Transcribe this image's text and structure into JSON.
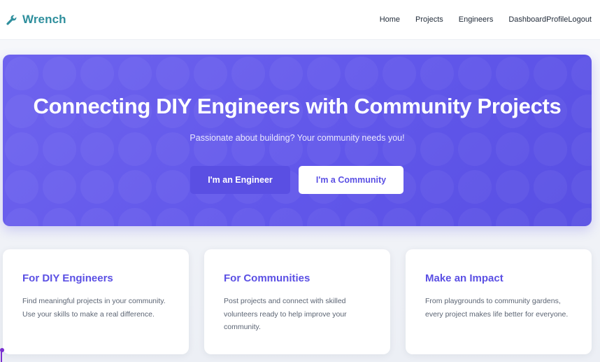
{
  "brand": {
    "name": "Wrench",
    "icon": "wrench-icon",
    "color": "#2f8f9d"
  },
  "nav": {
    "home": "Home",
    "projects": "Projects",
    "engineers": "Engineers",
    "dashboard": "Dashboard",
    "profile": "Profile",
    "logout": "Logout"
  },
  "hero": {
    "title": "Connecting DIY Engineers with Community Projects",
    "subtitle": "Passionate about building? Your community needs you!",
    "engineer_button": "I'm an Engineer",
    "community_button": "I'm a Community",
    "accent": "#6157ea"
  },
  "cards": [
    {
      "title": "For DIY Engineers",
      "text": "Find meaningful projects in your community. Use your skills to make a real difference."
    },
    {
      "title": "For Communities",
      "text": "Post projects and connect with skilled volunteers ready to help improve your community."
    },
    {
      "title": "Make an Impact",
      "text": "From playgrounds to community gardens, every project makes life better for everyone."
    }
  ]
}
